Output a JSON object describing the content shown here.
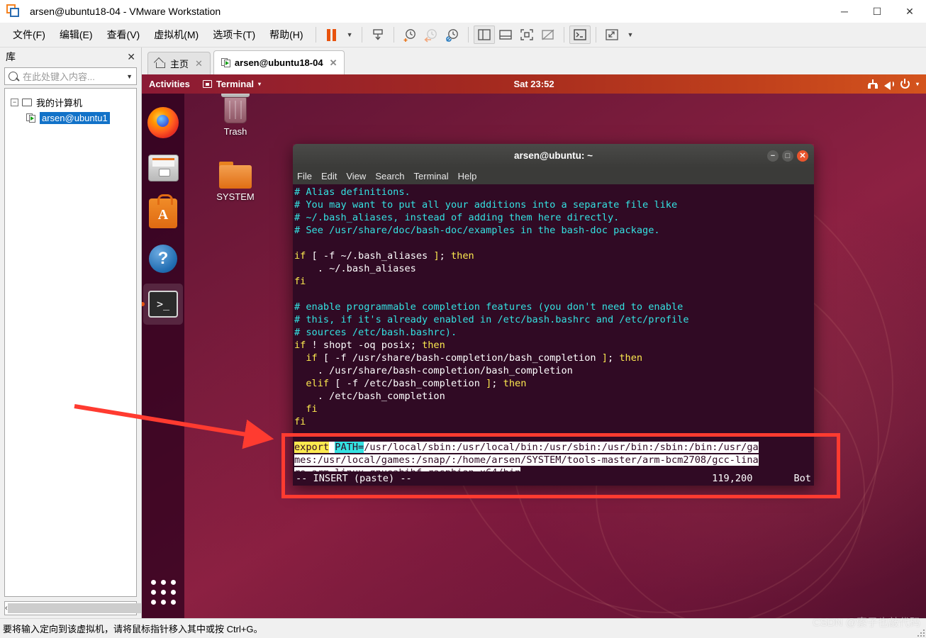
{
  "window": {
    "title": "arsen@ubuntu18-04 - VMware Workstation",
    "logo_icon": "vmware-logo-icon",
    "minimize": "─",
    "maximize": "☐",
    "close": "✕"
  },
  "menubar": {
    "items": [
      {
        "label": "文件(F)",
        "name": "menu-file"
      },
      {
        "label": "编辑(E)",
        "name": "menu-edit"
      },
      {
        "label": "查看(V)",
        "name": "menu-view"
      },
      {
        "label": "虚拟机(M)",
        "name": "menu-vm"
      },
      {
        "label": "选项卡(T)",
        "name": "menu-tabs"
      },
      {
        "label": "帮助(H)",
        "name": "menu-help"
      }
    ],
    "toolbar_icons": [
      "pause-icon",
      "dropdown-caret-icon",
      "send-ctrl-alt-del-icon",
      "snapshot-take-icon",
      "snapshot-revert-icon",
      "snapshot-manager-icon",
      "show-library-icon",
      "show-thumbnails-icon",
      "fullscreen-icon",
      "unity-mode-icon",
      "console-view-icon",
      "stretch-icon",
      "stretch-caret-icon"
    ]
  },
  "sidebar": {
    "title": "库",
    "close_label": "✕",
    "search": {
      "placeholder": "在此处键入内容...",
      "value": "",
      "icon": "search-icon",
      "caret": "▼"
    },
    "tree": [
      {
        "label": "我的计算机",
        "expander": "−",
        "icon": "monitor-icon",
        "selected": false
      },
      {
        "label": "arsen@ubuntu1",
        "icon": "vm-icon",
        "selected": true
      }
    ],
    "scroll_left": "‹",
    "scroll_right": "›"
  },
  "tabs": [
    {
      "label": "主页",
      "icon": "home-icon",
      "close": "✕",
      "active": false
    },
    {
      "label": "arsen@ubuntu18-04",
      "icon": "vm-icon",
      "close": "✕",
      "active": true
    }
  ],
  "guest": {
    "topbar": {
      "activities": "Activities",
      "app_name": "Terminal",
      "app_caret": "▾",
      "clock": "Sat 23:52",
      "icons": [
        "network-icon",
        "volume-icon",
        "power-icon",
        "system-menu-caret-icon"
      ]
    },
    "dock": [
      {
        "name": "dock-item-firefox",
        "label": "Firefox",
        "active": false
      },
      {
        "name": "dock-item-files",
        "label": "Files",
        "active": false
      },
      {
        "name": "dock-item-software",
        "label": "Ubuntu Software",
        "active": false
      },
      {
        "name": "dock-item-help",
        "label": "Help",
        "active": false
      },
      {
        "name": "dock-item-terminal",
        "label": "Terminal",
        "active": true
      }
    ],
    "show_applications": "Show Applications",
    "desktop_icons": [
      {
        "label": "Trash",
        "name": "desktop-icon-trash"
      },
      {
        "label": "SYSTEM",
        "name": "desktop-icon-system"
      }
    ]
  },
  "terminal": {
    "title": "arsen@ubuntu: ~",
    "window_buttons": {
      "minimize": "−",
      "maximize": "□",
      "close": "✕"
    },
    "menu": [
      "File",
      "Edit",
      "View",
      "Search",
      "Terminal",
      "Help"
    ],
    "lines": [
      {
        "segments": [
          {
            "t": "# Alias definitions.",
            "c": "c-cyan"
          }
        ]
      },
      {
        "segments": [
          {
            "t": "# You may want to put all your additions into a separate file like",
            "c": "c-cyan"
          }
        ]
      },
      {
        "segments": [
          {
            "t": "# ~/.bash_aliases, instead of adding them here directly.",
            "c": "c-cyan"
          }
        ]
      },
      {
        "segments": [
          {
            "t": "# See /usr/share/doc/bash-doc/examples in the bash-doc package.",
            "c": "c-cyan"
          }
        ]
      },
      {
        "segments": [
          {
            "t": "",
            "c": "c-white"
          }
        ]
      },
      {
        "segments": [
          {
            "t": "if",
            "c": "c-yellow"
          },
          {
            "t": " [ -f ~/.bash_aliases ",
            "c": "c-white"
          },
          {
            "t": "]",
            "c": "c-yellow"
          },
          {
            "t": "; ",
            "c": "c-white"
          },
          {
            "t": "then",
            "c": "c-yellow"
          }
        ]
      },
      {
        "segments": [
          {
            "t": "    . ~/.bash_aliases",
            "c": "c-white"
          }
        ]
      },
      {
        "segments": [
          {
            "t": "fi",
            "c": "c-yellow"
          }
        ]
      },
      {
        "segments": [
          {
            "t": "",
            "c": "c-white"
          }
        ]
      },
      {
        "segments": [
          {
            "t": "# enable programmable completion features (you don't need to enable",
            "c": "c-cyan"
          }
        ]
      },
      {
        "segments": [
          {
            "t": "# this, if it's already enabled in /etc/bash.bashrc and /etc/profile",
            "c": "c-cyan"
          }
        ]
      },
      {
        "segments": [
          {
            "t": "# sources /etc/bash.bashrc).",
            "c": "c-cyan"
          }
        ]
      },
      {
        "segments": [
          {
            "t": "if",
            "c": "c-yellow"
          },
          {
            "t": " ! shopt -oq posix; ",
            "c": "c-white"
          },
          {
            "t": "then",
            "c": "c-yellow"
          }
        ]
      },
      {
        "segments": [
          {
            "t": "  ",
            "c": "c-white"
          },
          {
            "t": "if",
            "c": "c-yellow"
          },
          {
            "t": " [ -f /usr/share/bash-completion/bash_completion ",
            "c": "c-white"
          },
          {
            "t": "]",
            "c": "c-yellow"
          },
          {
            "t": "; ",
            "c": "c-white"
          },
          {
            "t": "then",
            "c": "c-yellow"
          }
        ]
      },
      {
        "segments": [
          {
            "t": "    . /usr/share/bash-completion/bash_completion",
            "c": "c-white"
          }
        ]
      },
      {
        "segments": [
          {
            "t": "  ",
            "c": "c-white"
          },
          {
            "t": "elif",
            "c": "c-yellow"
          },
          {
            "t": " [ -f /etc/bash_completion ",
            "c": "c-white"
          },
          {
            "t": "]",
            "c": "c-yellow"
          },
          {
            "t": "; ",
            "c": "c-white"
          },
          {
            "t": "then",
            "c": "c-yellow"
          }
        ]
      },
      {
        "segments": [
          {
            "t": "    . /etc/bash_completion",
            "c": "c-white"
          }
        ]
      },
      {
        "segments": [
          {
            "t": "  fi",
            "c": "c-yellow"
          }
        ]
      },
      {
        "segments": [
          {
            "t": "fi",
            "c": "c-yellow"
          }
        ]
      },
      {
        "segments": [
          {
            "t": "",
            "c": "c-white"
          }
        ]
      },
      {
        "segments": [
          {
            "t": "export",
            "c": "hl-exp"
          },
          {
            "t": " ",
            "c": "hl-inv"
          },
          {
            "t": "PATH=",
            "c": "hl-var"
          },
          {
            "t": "/usr/local/sbin:/usr/local/bin:/usr/sbin:/usr/bin:/sbin:/bin:/usr/ga",
            "c": "hl-inv"
          }
        ]
      },
      {
        "segments": [
          {
            "t": "mes:/usr/local/games:/snap/:/home/arsen/SYSTEM/tools-master/arm-bcm2708/gcc-lina",
            "c": "hl-inv"
          }
        ]
      },
      {
        "segments": [
          {
            "t": "ro-arm-linux-gnueabihf-raspbian-x64/bin",
            "c": "hl-inv"
          }
        ]
      }
    ],
    "status": {
      "mode": "-- INSERT (paste) --",
      "position": "119,200",
      "scroll": "Bot"
    }
  },
  "annotation": {
    "box_color": "#ff3b30",
    "arrow_color": "#ff3b30",
    "arrow_from": "105,573",
    "arrow_to": "392,622"
  },
  "statusbar": {
    "hint": "要将输入定向到该虚拟机，请将鼠标指针移入其中或按 Ctrl+G。",
    "watermark": "CSDN @索子也敲代码"
  }
}
